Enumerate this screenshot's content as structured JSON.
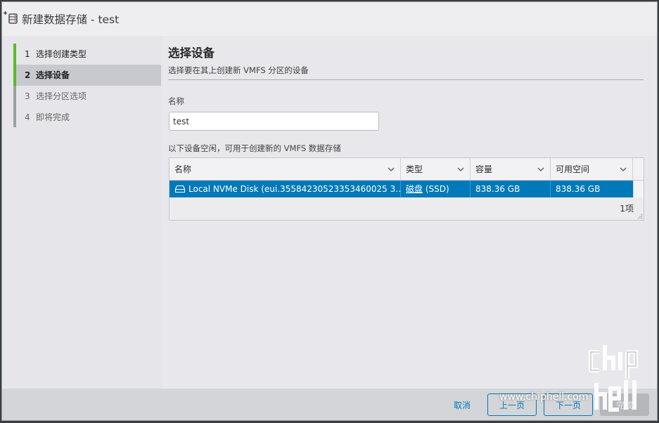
{
  "window": {
    "title": "新建数据存储 - test"
  },
  "nav": {
    "items": [
      {
        "num": "1",
        "label": "选择创建类型",
        "state": "done"
      },
      {
        "num": "2",
        "label": "选择设备",
        "state": "active"
      },
      {
        "num": "3",
        "label": "选择分区选项",
        "state": "future"
      },
      {
        "num": "4",
        "label": "即将完成",
        "state": "future"
      }
    ]
  },
  "main": {
    "title": "选择设备",
    "subtitle": "选择要在其上创建新 VMFS 分区的设备",
    "name_label": "名称",
    "name_value": "test",
    "devices_caption": "以下设备空闲，可用于创建新的 VMFS 数据存储",
    "grid": {
      "columns": [
        "名称",
        "类型",
        "容量",
        "可用空间"
      ],
      "rows": [
        {
          "name": "Local NVMe Disk (eui.35584230523353460025 3…",
          "type_link": "磁盘",
          "type_suffix": " (SSD)",
          "capacity": "838.36 GB",
          "free": "838.36 GB"
        }
      ],
      "footer": "1项"
    }
  },
  "footer": {
    "cancel": "取消",
    "back": "上一页",
    "next": "下一页",
    "finish": "完成"
  },
  "watermark": {
    "url": "www.chiphell.com"
  },
  "colors": {
    "accent": "#0079b8",
    "done_rail": "#5cb82a",
    "selected_row": "#0079b8"
  }
}
